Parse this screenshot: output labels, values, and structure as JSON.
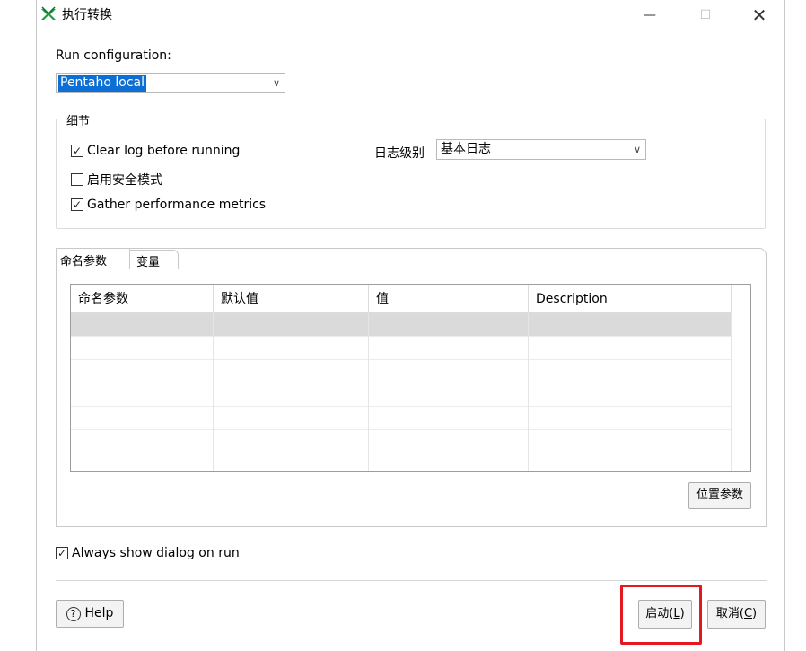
{
  "window": {
    "title": "执行转换"
  },
  "run_config": {
    "label": "Run configuration:",
    "value": "Pentaho local"
  },
  "details": {
    "title": "细节",
    "clear_log": {
      "label": "Clear log before running",
      "checked": true
    },
    "safe_mode": {
      "label": "启用安全模式",
      "checked": false
    },
    "perf_metrics": {
      "label": "Gather performance metrics",
      "checked": true
    },
    "log_level": {
      "label": "日志级别",
      "value": "基本日志"
    }
  },
  "tabs": [
    {
      "label": "命名参数",
      "selected": true
    },
    {
      "label": "变量",
      "selected": false
    }
  ],
  "table": {
    "columns": [
      "命名参数",
      "默认值",
      "值",
      "Description"
    ],
    "rows": [
      [
        "",
        "",
        "",
        ""
      ],
      [
        "",
        "",
        "",
        ""
      ],
      [
        "",
        "",
        "",
        ""
      ],
      [
        "",
        "",
        "",
        ""
      ],
      [
        "",
        "",
        "",
        ""
      ],
      [
        "",
        "",
        "",
        ""
      ],
      [
        "",
        "",
        "",
        ""
      ]
    ]
  },
  "positional_params_button": "位置参数",
  "always_show": {
    "label": "Always show dialog on run",
    "checked": true
  },
  "buttons": {
    "help": "Help",
    "start": "启动",
    "start_mnemonic": "L",
    "cancel": "取消",
    "cancel_mnemonic": "C"
  },
  "colors": {
    "selection": "#0b6fd6",
    "highlight_box": "#e3191f",
    "icon_green": "#1a9b3d"
  }
}
